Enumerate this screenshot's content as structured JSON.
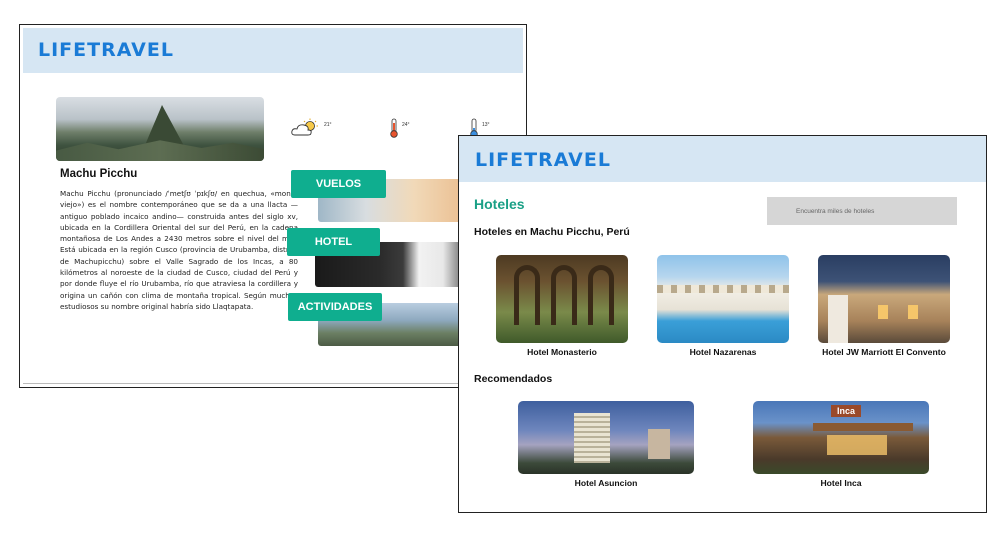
{
  "back_window": {
    "logo": "LIFETRAVEL",
    "place_title": "Machu Picchu",
    "description": "Machu Picchu (pronunciado /ˈmetʃʊ ˈpɪkʃʊ/ en quechua, «monte viejo») es el nombre contemporáneo que se da a una llacta —antiguo poblado incaico andino— construida antes del siglo xv, ubicada en la Cordillera Oriental del sur del Perú, en la cadena montañosa de Los Andes a 2430 metros sobre el nivel del mar. Está ubicada en la región Cusco (provincia de Urubamba, distrito de Machupicchu) sobre el Valle Sagrado de los Incas, a 80 kilómetros al noroeste de la ciudad de Cusco, ciudad del Perú y por donde fluye el río Urubamba, río que atraviesa la cordillera y origina un cañón con clima de montaña tropical. Según muchos estudiosos su nombre original habría sido Llaqtapata.",
    "weather": [
      {
        "icon": "partly-cloudy-icon",
        "temp": "21°"
      },
      {
        "icon": "thermometer-hot-icon",
        "temp": "24°"
      },
      {
        "icon": "thermometer-cold-icon",
        "temp": "13°"
      }
    ],
    "categories": [
      {
        "label": "VUELOS"
      },
      {
        "label": "HOTEL"
      },
      {
        "label": "ACTIVIDADES"
      }
    ]
  },
  "front_window": {
    "logo": "LIFETRAVEL",
    "title": "Hoteles",
    "search_placeholder": "Encuentra miles de hoteles",
    "section_hotels": "Hoteles en Machu Picchu, Perú",
    "hotels": [
      {
        "name": "Hotel Monasterio"
      },
      {
        "name": "Hotel Nazarenas"
      },
      {
        "name": "Hotel JW Marriott El Convento"
      }
    ],
    "section_recommended": "Recomendados",
    "recommended": [
      {
        "name": "Hotel Asuncion"
      },
      {
        "name": "Hotel Inca",
        "sign": "Inca"
      }
    ]
  },
  "colors": {
    "header_bg": "#d6e6f3",
    "logo": "#1a7bd6",
    "accent": "#0fae8f",
    "search_bg": "#d6d6d6"
  }
}
